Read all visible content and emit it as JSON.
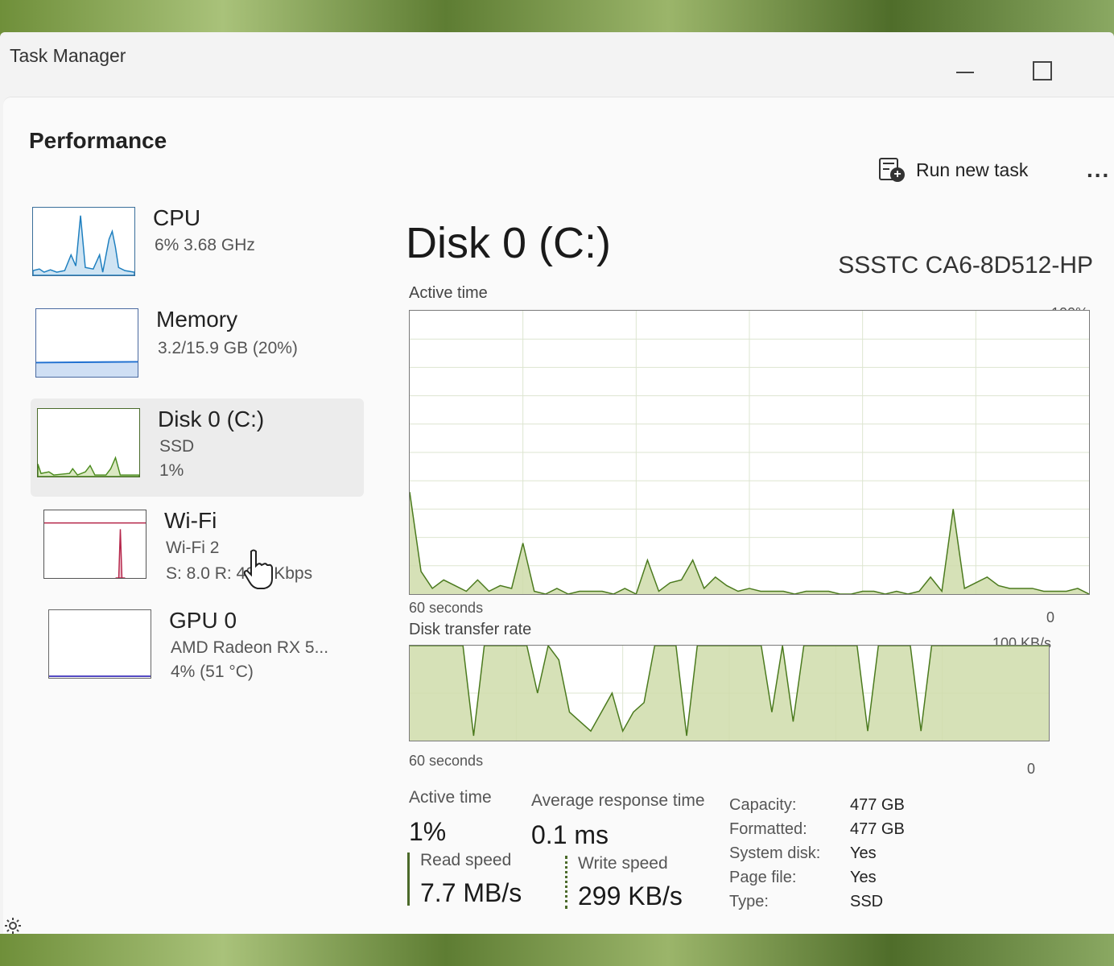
{
  "window": {
    "title": "Task Manager"
  },
  "header": {
    "page_title": "Performance",
    "run_new_task": "Run new task",
    "more": "..."
  },
  "sidebar": {
    "items": [
      {
        "name": "CPU",
        "sub1": "6% 3.68 GHz",
        "sub2": "",
        "color": "#1e7fbf"
      },
      {
        "name": "Memory",
        "sub1": "3.2/15.9 GB (20%)",
        "sub2": "",
        "color": "#1e6fd0"
      },
      {
        "name": "Disk 0 (C:)",
        "sub1": "SSD",
        "sub2": "1%",
        "color": "#4b8b1e"
      },
      {
        "name": "Wi-Fi",
        "sub1": "Wi-Fi 2",
        "sub2": "S: 8.0 R: 40.0 Kbps",
        "color": "#b5264a"
      },
      {
        "name": "GPU 0",
        "sub1": "AMD Radeon RX 5...",
        "sub2": "4% (51 °C)",
        "color": "#4a3fbf"
      }
    ],
    "active_index": 2
  },
  "detail": {
    "title": "Disk 0 (C:)",
    "model": "SSSTC CA6-8D512-HP",
    "active_chart": {
      "label": "Active time",
      "max": "100%",
      "min": "0",
      "time": "60 seconds"
    },
    "transfer_chart": {
      "label": "Disk transfer rate",
      "max": "100 KB/s",
      "min": "0",
      "time": "60 seconds"
    },
    "stats": {
      "active_time_label": "Active time",
      "active_time_value": "1%",
      "avg_response_label": "Average response time",
      "avg_response_value": "0.1 ms",
      "read_label": "Read speed",
      "read_value": "7.7 MB/s",
      "write_label": "Write speed",
      "write_value": "299 KB/s"
    },
    "info": [
      {
        "key": "Capacity:",
        "value": "477 GB"
      },
      {
        "key": "Formatted:",
        "value": "477 GB"
      },
      {
        "key": "System disk:",
        "value": "Yes"
      },
      {
        "key": "Page file:",
        "value": "Yes"
      },
      {
        "key": "Type:",
        "value": "SSD"
      }
    ]
  },
  "chart_data": [
    {
      "type": "area",
      "title": "Active time",
      "xlabel": "60 seconds",
      "ylim": [
        0,
        100
      ],
      "x": [
        0,
        1,
        2,
        3,
        4,
        5,
        6,
        7,
        8,
        9,
        10,
        11,
        12,
        13,
        14,
        15,
        16,
        17,
        18,
        19,
        20,
        21,
        22,
        23,
        24,
        25,
        26,
        27,
        28,
        29,
        30,
        31,
        32,
        33,
        34,
        35,
        36,
        37,
        38,
        39,
        40,
        41,
        42,
        43,
        44,
        45,
        46,
        47,
        48,
        49,
        50,
        51,
        52,
        53,
        54,
        55,
        56,
        57,
        58,
        59,
        60
      ],
      "series": [
        {
          "values": [
            36,
            8,
            2,
            5,
            3,
            1,
            5,
            1,
            3,
            2,
            18,
            1,
            0,
            2,
            0,
            1,
            1,
            1,
            0,
            2,
            0,
            12,
            1,
            4,
            5,
            12,
            2,
            6,
            3,
            1,
            2,
            1,
            1,
            1,
            0,
            1,
            1,
            1,
            0,
            0,
            1,
            1,
            0,
            1,
            0,
            1,
            6,
            1,
            30,
            2,
            4,
            6,
            3,
            2,
            2,
            2,
            1,
            1,
            1,
            2,
            0
          ]
        }
      ]
    },
    {
      "type": "area",
      "title": "Disk transfer rate",
      "xlabel": "60 seconds",
      "ylim": [
        0,
        100
      ],
      "x": [
        0,
        1,
        2,
        3,
        4,
        5,
        6,
        7,
        8,
        9,
        10,
        11,
        12,
        13,
        14,
        15,
        16,
        17,
        18,
        19,
        20,
        21,
        22,
        23,
        24,
        25,
        26,
        27,
        28,
        29,
        30,
        31,
        32,
        33,
        34,
        35,
        36,
        37,
        38,
        39,
        40,
        41,
        42,
        43,
        44,
        45,
        46,
        47,
        48,
        49,
        50,
        51,
        52,
        53,
        54,
        55,
        56,
        57,
        58,
        59,
        60
      ],
      "series": [
        {
          "values": [
            100,
            100,
            100,
            100,
            100,
            100,
            5,
            100,
            100,
            100,
            100,
            100,
            50,
            100,
            85,
            30,
            20,
            10,
            30,
            50,
            10,
            30,
            40,
            100,
            100,
            100,
            5,
            100,
            100,
            100,
            100,
            100,
            100,
            100,
            30,
            100,
            20,
            100,
            100,
            100,
            100,
            100,
            100,
            10,
            100,
            100,
            100,
            100,
            10,
            100,
            100,
            100,
            100,
            100,
            100,
            100,
            100,
            100,
            100,
            100,
            100
          ]
        }
      ]
    }
  ]
}
